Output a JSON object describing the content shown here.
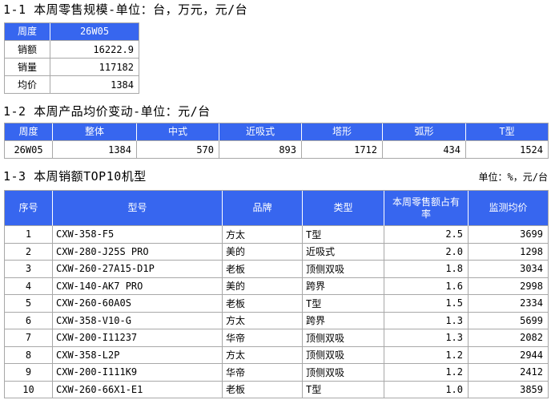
{
  "colors": {
    "header_bg": "#3766ef",
    "header_text": "#ffffff",
    "grid_line": "#a8a8a8"
  },
  "section1": {
    "title": "1-1 本周零售规模-单位：台，万元，元/台",
    "table": {
      "header": [
        "周度",
        "26W05"
      ],
      "rows": [
        [
          "销额",
          "16222.9"
        ],
        [
          "销量",
          "117182"
        ],
        [
          "均价",
          "1384"
        ]
      ]
    }
  },
  "section2": {
    "title": "1-2 本周产品均价变动-单位：元/台",
    "table": {
      "header": [
        "周度",
        "整体",
        "中式",
        "近吸式",
        "塔形",
        "弧形",
        "T型"
      ],
      "rows": [
        [
          "26W05",
          "1384",
          "570",
          "893",
          "1712",
          "434",
          "1524"
        ]
      ]
    }
  },
  "section3": {
    "title": "1-3 本周销额TOP10机型",
    "unit_note": "单位：%，元/台",
    "table": {
      "header": [
        "序号",
        "型号",
        "品牌",
        "类型",
        "本周零售额占有率",
        "监测均价"
      ],
      "rows": [
        [
          "1",
          "CXW-358-F5",
          "方太",
          "T型",
          "2.5",
          "3699"
        ],
        [
          "2",
          "CXW-280-J25S PRO",
          "美的",
          "近吸式",
          "2.0",
          "1298"
        ],
        [
          "3",
          "CXW-260-27A15-D1P",
          "老板",
          "顶侧双吸",
          "1.8",
          "3034"
        ],
        [
          "4",
          "CXW-140-AK7 PRO",
          "美的",
          "跨界",
          "1.6",
          "2998"
        ],
        [
          "5",
          "CXW-260-60A0S",
          "老板",
          "T型",
          "1.5",
          "2334"
        ],
        [
          "6",
          "CXW-358-V10-G",
          "方太",
          "跨界",
          "1.3",
          "5699"
        ],
        [
          "7",
          "CXW-200-I11237",
          "华帝",
          "顶侧双吸",
          "1.3",
          "2082"
        ],
        [
          "8",
          "CXW-358-L2P",
          "方太",
          "顶侧双吸",
          "1.2",
          "2944"
        ],
        [
          "9",
          "CXW-200-I111K9",
          "华帝",
          "顶侧双吸",
          "1.2",
          "2412"
        ],
        [
          "10",
          "CXW-260-66X1-E1",
          "老板",
          "T型",
          "1.0",
          "3859"
        ]
      ]
    }
  }
}
